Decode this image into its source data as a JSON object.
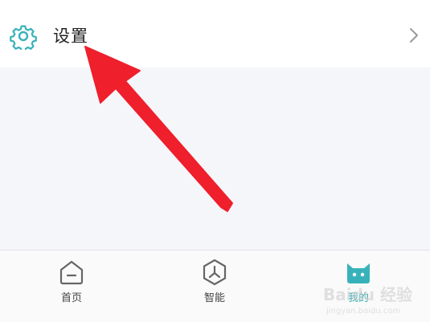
{
  "settings": {
    "label": "设置"
  },
  "tabs": [
    {
      "label": "首页",
      "icon": "home-icon",
      "active": false
    },
    {
      "label": "智能",
      "icon": "smart-icon",
      "active": false
    },
    {
      "label": "我的",
      "icon": "profile-icon",
      "active": true
    }
  ],
  "watermark": {
    "brand": "Baidu 经验",
    "site": "jingyan.baidu.com"
  },
  "colors": {
    "accent": "#38b2ba",
    "arrow": "#ef1f2c",
    "content_bg": "#f5f6fa"
  }
}
